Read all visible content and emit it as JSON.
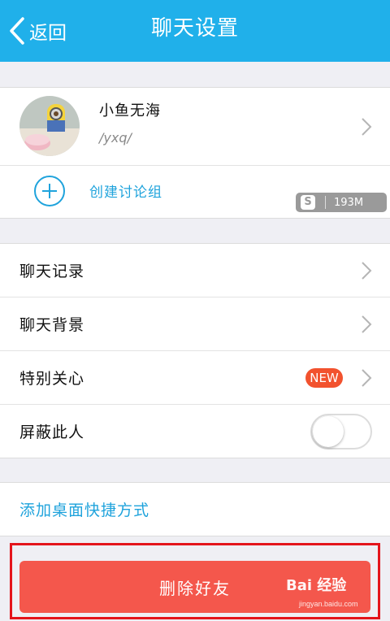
{
  "header": {
    "back_label": "返回",
    "title": "聊天设置"
  },
  "profile": {
    "name": "小鱼无海",
    "id": "/yxq/"
  },
  "create_group": {
    "label": "创建讨论组"
  },
  "memory_badge": {
    "icon_text": "S",
    "value": "193M"
  },
  "settings": {
    "items": [
      {
        "label": "聊天记录"
      },
      {
        "label": "聊天背景"
      },
      {
        "label": "特别关心",
        "badge": "NEW"
      },
      {
        "label": "屏蔽此人",
        "toggle": false
      }
    ]
  },
  "shortcut": {
    "label": "添加桌面快捷方式"
  },
  "delete_button": {
    "label": "删除好友"
  },
  "watermark": {
    "text": "Bai 经验",
    "sub": "jingyan.baidu.com"
  },
  "colors": {
    "header": "#20b0ea",
    "accent": "#1fa3dc",
    "delete": "#f4574c",
    "highlight": "#e4141b",
    "badge": "#f2522e"
  }
}
